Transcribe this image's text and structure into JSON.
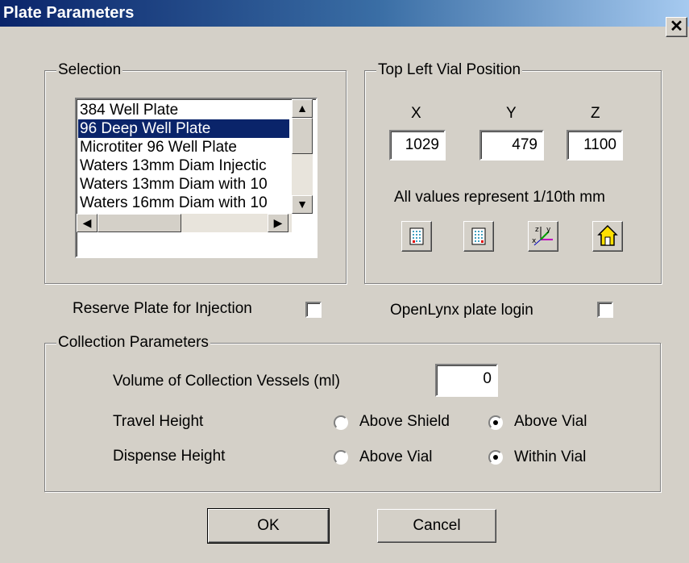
{
  "window": {
    "title": "Plate Parameters",
    "close_glyph": "✕"
  },
  "selection": {
    "legend": "Selection",
    "items": [
      "384 Well Plate",
      "96 Deep Well Plate",
      "Microtiter 96 Well Plate",
      "Waters 13mm Diam Injectic",
      "Waters 13mm Diam with 10",
      "Waters 16mm Diam with 10"
    ],
    "selected_index": 1,
    "scroll_up": "▲",
    "scroll_down": "▼",
    "scroll_left": "◀",
    "scroll_right": "▶"
  },
  "vial_position": {
    "legend": "Top Left Vial Position",
    "x_label": "X",
    "y_label": "Y",
    "z_label": "Z",
    "x_value": "1029",
    "y_value": "479",
    "z_value": "1100",
    "units_note": "All values represent 1/10th mm",
    "tool_icons": [
      "grid-top-left-icon",
      "grid-bottom-right-icon",
      "xyz-axes-icon",
      "home-icon"
    ]
  },
  "options": {
    "reserve_label": "Reserve Plate for Injection",
    "reserve_checked": false,
    "openlynx_label": "OpenLynx plate login",
    "openlynx_checked": false
  },
  "collection": {
    "legend": "Collection Parameters",
    "volume_label": "Volume of Collection Vessels (ml)",
    "volume_value": "0",
    "travel_label": "Travel Height",
    "travel_options": [
      "Above Shield",
      "Above Vial"
    ],
    "travel_selected": "Above Vial",
    "dispense_label": "Dispense Height",
    "dispense_options": [
      "Above Vial",
      "Within Vial"
    ],
    "dispense_selected": "Within Vial"
  },
  "buttons": {
    "ok": "OK",
    "cancel": "Cancel"
  }
}
